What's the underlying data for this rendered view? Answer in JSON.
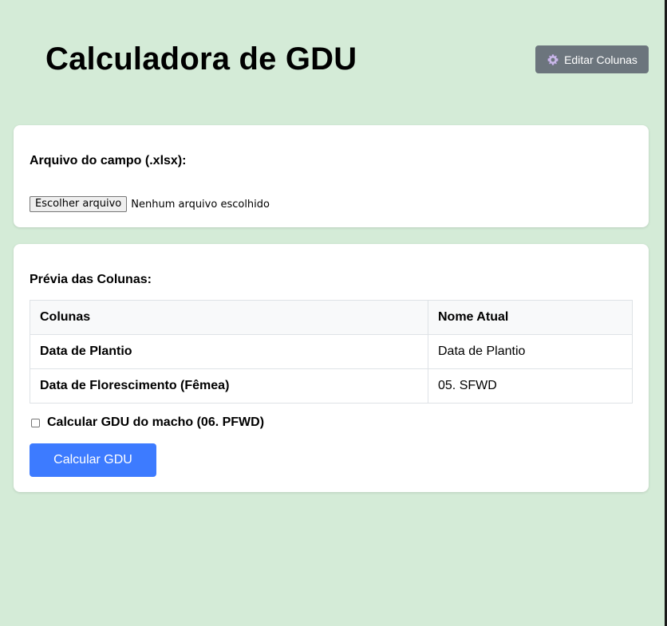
{
  "header": {
    "title": "Calculadora de GDU",
    "edit_columns_label": "Editar Colunas",
    "edit_columns_icon": "gear-icon"
  },
  "file_upload": {
    "label": "Arquivo do campo (.xlsx):",
    "choose_button": "Escolher arquivo",
    "status": "Nenhum arquivo escolhido"
  },
  "preview": {
    "label": "Prévia das Colunas:",
    "headers": [
      "Colunas",
      "Nome Atual"
    ],
    "rows": [
      {
        "column": "Data de Plantio",
        "current_name": "Data de Plantio"
      },
      {
        "column": "Data de Florescimento (Fêmea)",
        "current_name": "05. SFWD"
      }
    ],
    "checkbox_label": "Calcular GDU do macho (06. PFWD)",
    "checkbox_checked": false,
    "calculate_button": "Calcular GDU"
  },
  "colors": {
    "background": "#d4ebd7",
    "edit_button": "#6c757d",
    "primary_button": "#3d7bff"
  }
}
